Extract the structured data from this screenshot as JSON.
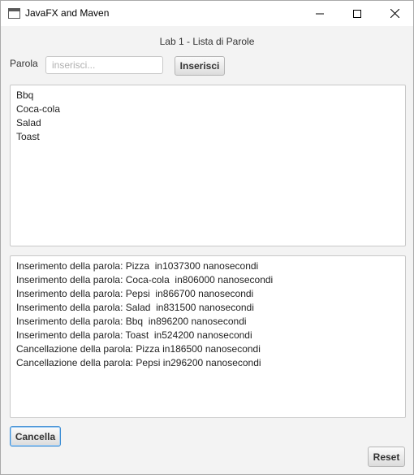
{
  "window": {
    "title": "JavaFX and Maven"
  },
  "heading": "Lab 1 - Lista di Parole",
  "form": {
    "label": "Parola",
    "input_value": "",
    "input_placeholder": "inserisci...",
    "insert_label": "Inserisci"
  },
  "words": [
    "Bbq",
    "Coca-cola",
    "Salad",
    "Toast"
  ],
  "log": [
    "Inserimento della parola: Pizza  in1037300 nanosecondi",
    "Inserimento della parola: Coca-cola  in806000 nanosecondi",
    "Inserimento della parola: Pepsi  in866700 nanosecondi",
    "Inserimento della parola: Salad  in831500 nanosecondi",
    "Inserimento della parola: Bbq  in896200 nanosecondi",
    "Inserimento della parola: Toast  in524200 nanosecondi",
    "Cancellazione della parola: Pizza in186500 nanosecondi",
    "Cancellazione della parola: Pepsi in296200 nanosecondi"
  ],
  "buttons": {
    "cancella": "Cancella",
    "reset": "Reset"
  }
}
